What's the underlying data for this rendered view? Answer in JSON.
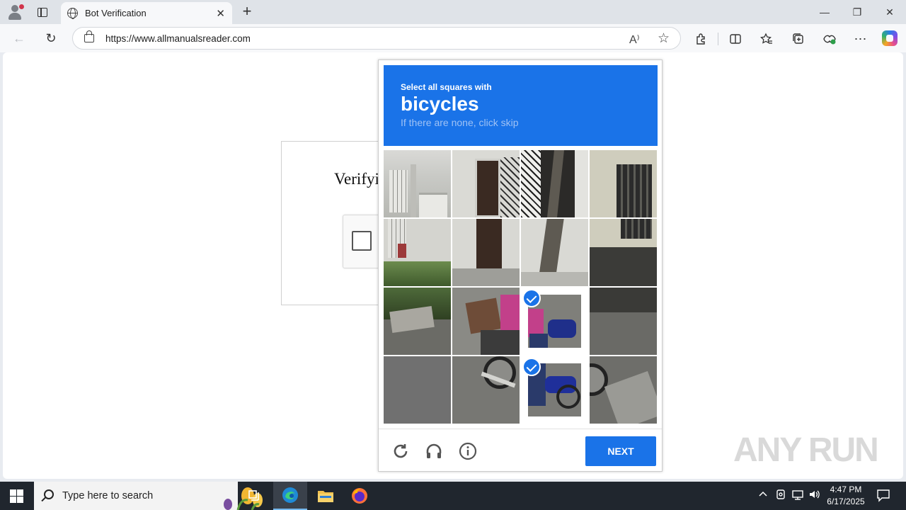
{
  "browser": {
    "tab_title": "Bot Verification",
    "tab_close": "✕",
    "new_tab": "+",
    "url": "https://www.allmanualsreader.com",
    "window_controls": {
      "minimize": "—",
      "maximize": "❐",
      "close": "✕"
    },
    "nav": {
      "back": "←",
      "refresh": "↻"
    },
    "address_icons": {
      "read_aloud": "A⁾",
      "favorite": "☆"
    },
    "toolbar_icons": [
      "extensions-icon",
      "split-screen-icon",
      "favorites-icon",
      "collections-icon",
      "browser-essentials-icon",
      "more-icon",
      "copilot-icon"
    ]
  },
  "page": {
    "heading": "Verifyi"
  },
  "captcha": {
    "instruction": "Select all squares with",
    "target": "bicycles",
    "hint": "If there are none, click skip",
    "tiles": [
      {
        "selected": false
      },
      {
        "selected": false
      },
      {
        "selected": false
      },
      {
        "selected": false
      },
      {
        "selected": false
      },
      {
        "selected": false
      },
      {
        "selected": false
      },
      {
        "selected": false
      },
      {
        "selected": false
      },
      {
        "selected": false
      },
      {
        "selected": true
      },
      {
        "selected": false
      },
      {
        "selected": false
      },
      {
        "selected": false
      },
      {
        "selected": true
      },
      {
        "selected": false
      }
    ],
    "next_label": "NEXT",
    "footer_icons": [
      "reload-icon",
      "audio-icon",
      "info-icon"
    ]
  },
  "watermark": "ANY RUN",
  "taskbar": {
    "search_placeholder": "Type here to search",
    "time": "4:47 PM",
    "date": "6/17/2025"
  }
}
